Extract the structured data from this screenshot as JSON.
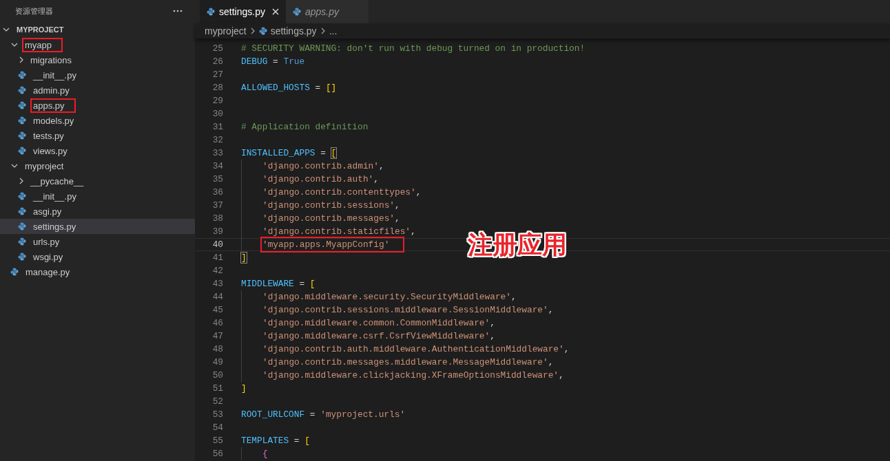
{
  "sidebar": {
    "title": "资源管理器",
    "tree": {
      "label": "MYPROJECT",
      "kind": "root",
      "expanded": true,
      "selected": false,
      "children": [
        {
          "label": "myapp",
          "kind": "folder",
          "expanded": true,
          "selected": false,
          "boxed": true,
          "children": [
            {
              "label": "migrations",
              "kind": "folder",
              "expanded": false,
              "selected": false
            },
            {
              "label": "__init__.py",
              "kind": "file",
              "selected": false
            },
            {
              "label": "admin.py",
              "kind": "file",
              "selected": false
            },
            {
              "label": "apps.py",
              "kind": "file",
              "selected": false,
              "boxed": true
            },
            {
              "label": "models.py",
              "kind": "file",
              "selected": false
            },
            {
              "label": "tests.py",
              "kind": "file",
              "selected": false
            },
            {
              "label": "views.py",
              "kind": "file",
              "selected": false
            }
          ]
        },
        {
          "label": "myproject",
          "kind": "folder",
          "expanded": true,
          "selected": false,
          "children": [
            {
              "label": "__pycache__",
              "kind": "folder",
              "expanded": false,
              "selected": false
            },
            {
              "label": "__init__.py",
              "kind": "file",
              "selected": false
            },
            {
              "label": "asgi.py",
              "kind": "file",
              "selected": false
            },
            {
              "label": "settings.py",
              "kind": "file",
              "selected": true
            },
            {
              "label": "urls.py",
              "kind": "file",
              "selected": false
            },
            {
              "label": "wsgi.py",
              "kind": "file",
              "selected": false
            }
          ]
        },
        {
          "label": "manage.py",
          "kind": "file",
          "selected": false
        }
      ]
    }
  },
  "tabs": [
    {
      "label": "settings.py",
      "selected": true,
      "preview": false
    },
    {
      "label": "apps.py",
      "selected": false,
      "preview": true
    }
  ],
  "breadcrumbs": [
    {
      "label": "myproject",
      "kind": "folder"
    },
    {
      "label": "settings.py",
      "kind": "file"
    },
    {
      "label": "...",
      "kind": "symbol"
    }
  ],
  "code": [
    {
      "number": "25",
      "current": false,
      "tokens": [
        {
          "kind": "comment",
          "text": "# SECURITY WARNING: don't run with debug turned on in production!"
        }
      ]
    },
    {
      "number": "26",
      "current": false,
      "tokens": [
        {
          "kind": "name",
          "text": "DEBUG"
        },
        {
          "kind": "op",
          "text": " = "
        },
        {
          "kind": "keyword",
          "text": "True"
        }
      ]
    },
    {
      "number": "27",
      "current": false
    },
    {
      "number": "28",
      "current": false,
      "tokens": [
        {
          "kind": "name",
          "text": "ALLOWED_HOSTS"
        },
        {
          "kind": "op",
          "text": " = "
        },
        {
          "kind": "bracket",
          "text": "[]"
        }
      ]
    },
    {
      "number": "29",
      "current": false
    },
    {
      "number": "30",
      "current": false
    },
    {
      "number": "31",
      "current": false,
      "tokens": [
        {
          "kind": "comment",
          "text": "# Application definition"
        }
      ]
    },
    {
      "number": "32",
      "current": false
    },
    {
      "number": "33",
      "current": false,
      "tokens": [
        {
          "kind": "name",
          "text": "INSTALLED_APPS"
        },
        {
          "kind": "op",
          "text": " = "
        },
        {
          "kind": "bracket-match",
          "text": "["
        }
      ]
    },
    {
      "number": "34",
      "current": false,
      "indented": true,
      "tokens": [
        {
          "kind": "string",
          "text": "'django.contrib.admin'"
        },
        {
          "kind": "op",
          "text": ","
        }
      ]
    },
    {
      "number": "35",
      "current": false,
      "indented": true,
      "tokens": [
        {
          "kind": "string",
          "text": "'django.contrib.auth'"
        },
        {
          "kind": "op",
          "text": ","
        }
      ]
    },
    {
      "number": "36",
      "current": false,
      "indented": true,
      "tokens": [
        {
          "kind": "string",
          "text": "'django.contrib.contenttypes'"
        },
        {
          "kind": "op",
          "text": ","
        }
      ]
    },
    {
      "number": "37",
      "current": false,
      "indented": true,
      "tokens": [
        {
          "kind": "string",
          "text": "'django.contrib.sessions'"
        },
        {
          "kind": "op",
          "text": ","
        }
      ]
    },
    {
      "number": "38",
      "current": false,
      "indented": true,
      "tokens": [
        {
          "kind": "string",
          "text": "'django.contrib.messages'"
        },
        {
          "kind": "op",
          "text": ","
        }
      ]
    },
    {
      "number": "39",
      "current": false,
      "indented": true,
      "tokens": [
        {
          "kind": "string",
          "text": "'django.contrib.staticfiles'"
        },
        {
          "kind": "op",
          "text": ","
        }
      ]
    },
    {
      "number": "40",
      "current": true,
      "indented": true,
      "boxed": true,
      "tokens": [
        {
          "kind": "string",
          "text": "'myapp.apps.MyappConfig'"
        }
      ]
    },
    {
      "number": "41",
      "current": false,
      "tokens": [
        {
          "kind": "bracket-match",
          "text": "]"
        }
      ]
    },
    {
      "number": "42",
      "current": false
    },
    {
      "number": "43",
      "current": false,
      "tokens": [
        {
          "kind": "name",
          "text": "MIDDLEWARE"
        },
        {
          "kind": "op",
          "text": " = "
        },
        {
          "kind": "bracket",
          "text": "["
        }
      ]
    },
    {
      "number": "44",
      "current": false,
      "indented": true,
      "tokens": [
        {
          "kind": "string",
          "text": "'django.middleware.security.SecurityMiddleware'"
        },
        {
          "kind": "op",
          "text": ","
        }
      ]
    },
    {
      "number": "45",
      "current": false,
      "indented": true,
      "tokens": [
        {
          "kind": "string",
          "text": "'django.contrib.sessions.middleware.SessionMiddleware'"
        },
        {
          "kind": "op",
          "text": ","
        }
      ]
    },
    {
      "number": "46",
      "current": false,
      "indented": true,
      "tokens": [
        {
          "kind": "string",
          "text": "'django.middleware.common.CommonMiddleware'"
        },
        {
          "kind": "op",
          "text": ","
        }
      ]
    },
    {
      "number": "47",
      "current": false,
      "indented": true,
      "tokens": [
        {
          "kind": "string",
          "text": "'django.middleware.csrf.CsrfViewMiddleware'"
        },
        {
          "kind": "op",
          "text": ","
        }
      ]
    },
    {
      "number": "48",
      "current": false,
      "indented": true,
      "tokens": [
        {
          "kind": "string",
          "text": "'django.contrib.auth.middleware.AuthenticationMiddleware'"
        },
        {
          "kind": "op",
          "text": ","
        }
      ]
    },
    {
      "number": "49",
      "current": false,
      "indented": true,
      "tokens": [
        {
          "kind": "string",
          "text": "'django.contrib.messages.middleware.MessageMiddleware'"
        },
        {
          "kind": "op",
          "text": ","
        }
      ]
    },
    {
      "number": "50",
      "current": false,
      "indented": true,
      "tokens": [
        {
          "kind": "string",
          "text": "'django.middleware.clickjacking.XFrameOptionsMiddleware'"
        },
        {
          "kind": "op",
          "text": ","
        }
      ]
    },
    {
      "number": "51",
      "current": false,
      "tokens": [
        {
          "kind": "bracket",
          "text": "]"
        }
      ]
    },
    {
      "number": "52",
      "current": false
    },
    {
      "number": "53",
      "current": false,
      "tokens": [
        {
          "kind": "name",
          "text": "ROOT_URLCONF"
        },
        {
          "kind": "op",
          "text": " = "
        },
        {
          "kind": "string",
          "text": "'myproject.urls'"
        }
      ]
    },
    {
      "number": "54",
      "current": false
    },
    {
      "number": "55",
      "current": false,
      "tokens": [
        {
          "kind": "name",
          "text": "TEMPLATES"
        },
        {
          "kind": "op",
          "text": " = "
        },
        {
          "kind": "bracket",
          "text": "["
        }
      ]
    },
    {
      "number": "56",
      "current": false,
      "indented": true,
      "tokens": [
        {
          "kind": "brace",
          "text": "{"
        }
      ]
    }
  ],
  "annotation": "注册应用"
}
